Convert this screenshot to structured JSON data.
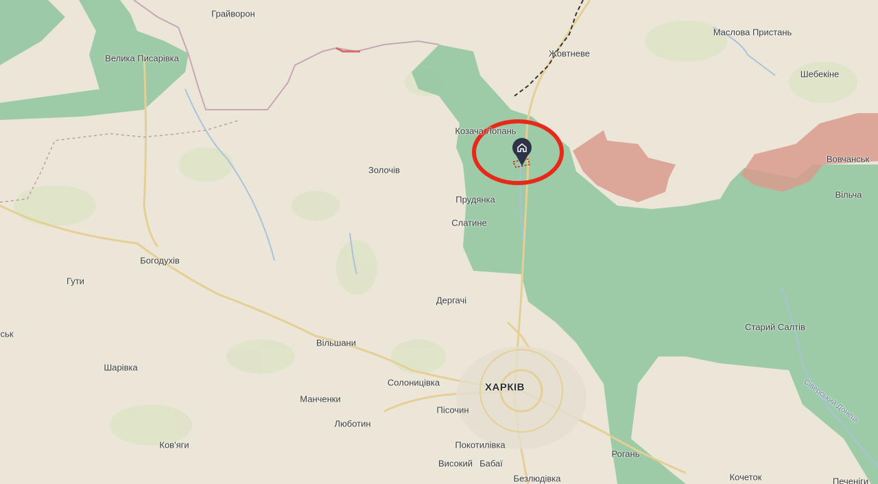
{
  "map": {
    "colors": {
      "land": "#ebe6d8",
      "controlled": "#8fc6a0",
      "occupied": "#d99b8e",
      "marker": "#2f3348",
      "highlight": "#e8291a"
    },
    "marker_icon": "home-pin-icon",
    "labels": {
      "graivoron": "Грайворон",
      "velyka_pysarivka": "Велика Писарівка",
      "zhovtneve": "Жовтневе",
      "maslova_prystan": "Маслова Пристань",
      "shebekyne": "Шебекіне",
      "kozacha_lopan": "Козача Лопань",
      "zolochiv": "Золочів",
      "vovchansk": "Вовчанськ",
      "prudianka": "Прудянка",
      "vilcha": "Вільча",
      "slatyne": "Слатине",
      "bohodukhiv": "Богодухів",
      "guty": "Гути",
      "derhachi": "Дергачі",
      "staryi_saltiv": "Старий Салтів",
      "vilshany": "Вільшани",
      "sk_partial": "ськ",
      "sharivka": "Шарівка",
      "solonytsivka": "Солоницівка",
      "kharkiv": "ХАРКІВ",
      "manchenky": "Манченки",
      "pisochyn": "Пісочин",
      "siverskyi_donets": "Сіверський Донець",
      "liubotyn": "Люботин",
      "kovyagy": "Ков'яги",
      "pokotylivka": "Покотилівка",
      "rohan": "Рогань",
      "vysokyi": "Високий",
      "babai": "Бабаї",
      "bezliudivka": "Безлюдівка",
      "kochetok": "Кочеток",
      "pechenihy": "Печеніги"
    }
  }
}
